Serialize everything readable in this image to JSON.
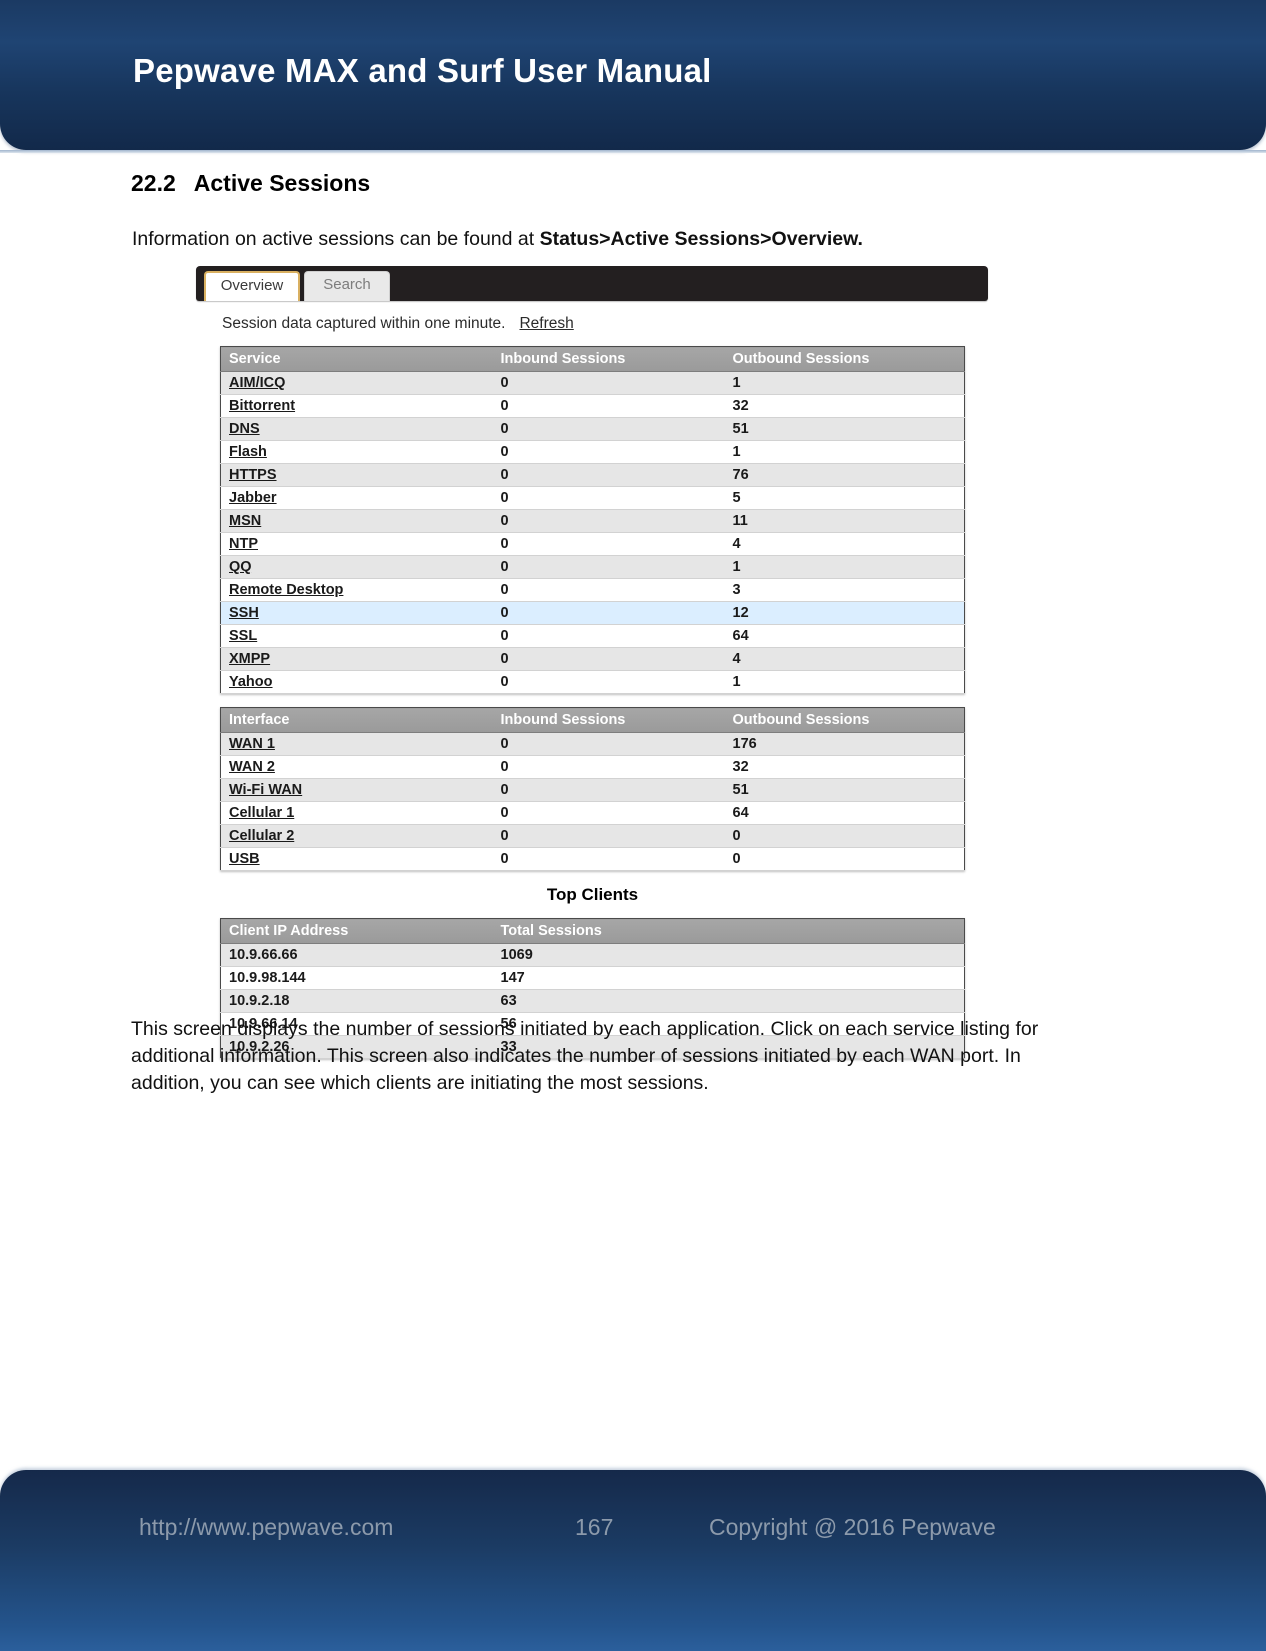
{
  "header": {
    "title": "Pepwave MAX and Surf User Manual"
  },
  "section": {
    "number": "22.2",
    "title": "Active Sessions",
    "intro_prefix": "Information on active sessions can be found at ",
    "intro_bold": "Status>Active Sessions>Overview."
  },
  "screenshot": {
    "tabs": [
      {
        "label": "Overview",
        "active": true
      },
      {
        "label": "Search",
        "active": false
      }
    ],
    "caption": "Session data captured within one minute.",
    "refresh_label": "Refresh",
    "service_table": {
      "columns": [
        "Service",
        "Inbound Sessions",
        "Outbound Sessions"
      ],
      "rows": [
        {
          "name": "AIM/ICQ",
          "inbound": "0",
          "outbound": "1",
          "highlight": false
        },
        {
          "name": "Bittorrent",
          "inbound": "0",
          "outbound": "32",
          "highlight": false
        },
        {
          "name": "DNS",
          "inbound": "0",
          "outbound": "51",
          "highlight": false
        },
        {
          "name": "Flash",
          "inbound": "0",
          "outbound": "1",
          "highlight": false
        },
        {
          "name": "HTTPS",
          "inbound": "0",
          "outbound": "76",
          "highlight": false
        },
        {
          "name": "Jabber",
          "inbound": "0",
          "outbound": "5",
          "highlight": false
        },
        {
          "name": "MSN",
          "inbound": "0",
          "outbound": "11",
          "highlight": false
        },
        {
          "name": "NTP",
          "inbound": "0",
          "outbound": "4",
          "highlight": false
        },
        {
          "name": "QQ",
          "inbound": "0",
          "outbound": "1",
          "highlight": false
        },
        {
          "name": "Remote Desktop",
          "inbound": "0",
          "outbound": "3",
          "highlight": false
        },
        {
          "name": "SSH",
          "inbound": "0",
          "outbound": "12",
          "highlight": true
        },
        {
          "name": "SSL",
          "inbound": "0",
          "outbound": "64",
          "highlight": false
        },
        {
          "name": "XMPP",
          "inbound": "0",
          "outbound": "4",
          "highlight": false
        },
        {
          "name": "Yahoo",
          "inbound": "0",
          "outbound": "1",
          "highlight": false
        }
      ]
    },
    "interface_table": {
      "columns": [
        "Interface",
        "Inbound Sessions",
        "Outbound Sessions"
      ],
      "rows": [
        {
          "name": "WAN 1",
          "inbound": "0",
          "outbound": "176"
        },
        {
          "name": "WAN 2",
          "inbound": "0",
          "outbound": "32"
        },
        {
          "name": "Wi-Fi WAN",
          "inbound": "0",
          "outbound": "51"
        },
        {
          "name": "Cellular 1",
          "inbound": "0",
          "outbound": "64"
        },
        {
          "name": "Cellular 2",
          "inbound": "0",
          "outbound": "0"
        },
        {
          "name": "USB",
          "inbound": "0",
          "outbound": "0"
        }
      ]
    },
    "top_clients": {
      "title": "Top Clients",
      "columns": [
        "Client IP Address",
        "Total Sessions"
      ],
      "rows": [
        {
          "ip": "10.9.66.66",
          "sessions": "1069"
        },
        {
          "ip": "10.9.98.144",
          "sessions": "147"
        },
        {
          "ip": "10.9.2.18",
          "sessions": "63"
        },
        {
          "ip": "10.9.66.14",
          "sessions": "56"
        },
        {
          "ip": "10.9.2.26",
          "sessions": "33"
        }
      ]
    }
  },
  "body_text": "This screen displays the number of sessions initiated by each application. Click on each service listing for additional information. This screen also indicates the number of sessions initiated by each WAN port. In addition, you can see which clients are initiating the most sessions.",
  "footer": {
    "url": "http://www.pepwave.com",
    "page": "167",
    "copyright": "Copyright @ 2016 Pepwave"
  },
  "colors": {
    "banner_dark": "#15294a",
    "banner_light": "#2b5f9c",
    "tab_accent": "#d9b061",
    "row_highlight": "#dbeeff",
    "table_header": "#a6a6a6"
  }
}
